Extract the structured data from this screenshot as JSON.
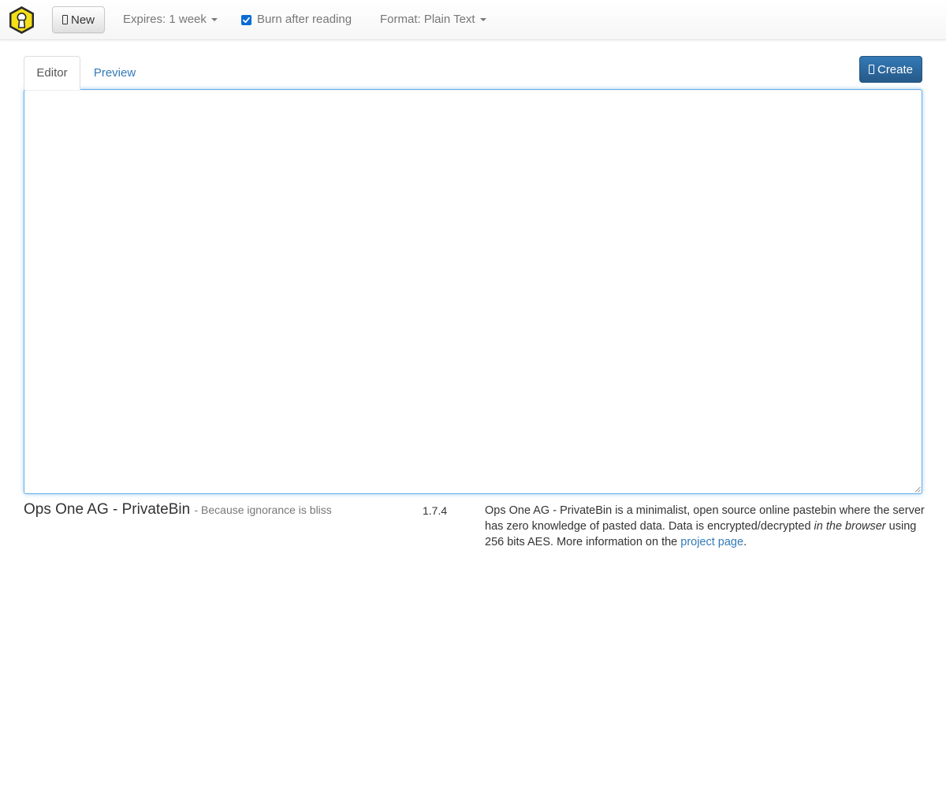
{
  "navbar": {
    "new_label": "New",
    "expires_label": "Expires: 1 week",
    "burn_label": "Burn after reading",
    "burn_checked": true,
    "format_label": "Format: Plain Text"
  },
  "tabs": {
    "editor_label": "Editor",
    "preview_label": "Preview"
  },
  "create_label": "Create",
  "editor": {
    "value": ""
  },
  "footer": {
    "title": "Ops One AG - PrivateBin",
    "tagline": "- Because ignorance is bliss",
    "version": "1.7.4",
    "about_part1": "Ops One AG - PrivateBin is a minimalist, open source online pastebin where the server has zero knowledge of pasted data. Data is encrypted/decrypted ",
    "about_emphasis": "in the browser",
    "about_part2": " using 256 bits AES. More information on the ",
    "about_link": "project page",
    "about_end": "."
  },
  "colors": {
    "accent": "#337ab7",
    "logo_yellow": "#f5df17",
    "checkbox": "#0b6bd3"
  },
  "icons": {
    "logo": "keyhole-logo-icon",
    "new": "file-icon",
    "create": "upload-icon"
  }
}
